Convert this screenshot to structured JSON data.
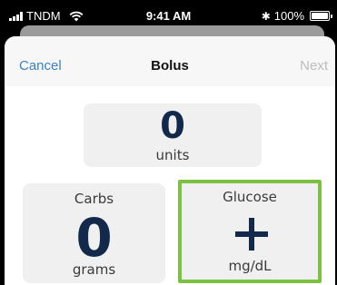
{
  "status_bar": {
    "carrier": "TNDM",
    "time": "9:41 AM",
    "bluetooth_icon": "bluetooth-icon",
    "battery": "100%",
    "battery_level": 1.0
  },
  "nav": {
    "cancel_label": "Cancel",
    "title": "Bolus",
    "next_label": "Next"
  },
  "units_tile": {
    "value": "0",
    "label": "units"
  },
  "carbs_tile": {
    "title": "Carbs",
    "value": "0",
    "unit": "grams"
  },
  "glucose_tile": {
    "title": "Glucose",
    "icon": "plus-icon",
    "unit": "mg/dL"
  },
  "colors": {
    "accent": "#3b82c4",
    "highlight": "#7cc142",
    "value_text": "#13294b",
    "disabled": "#bdbdbd"
  }
}
